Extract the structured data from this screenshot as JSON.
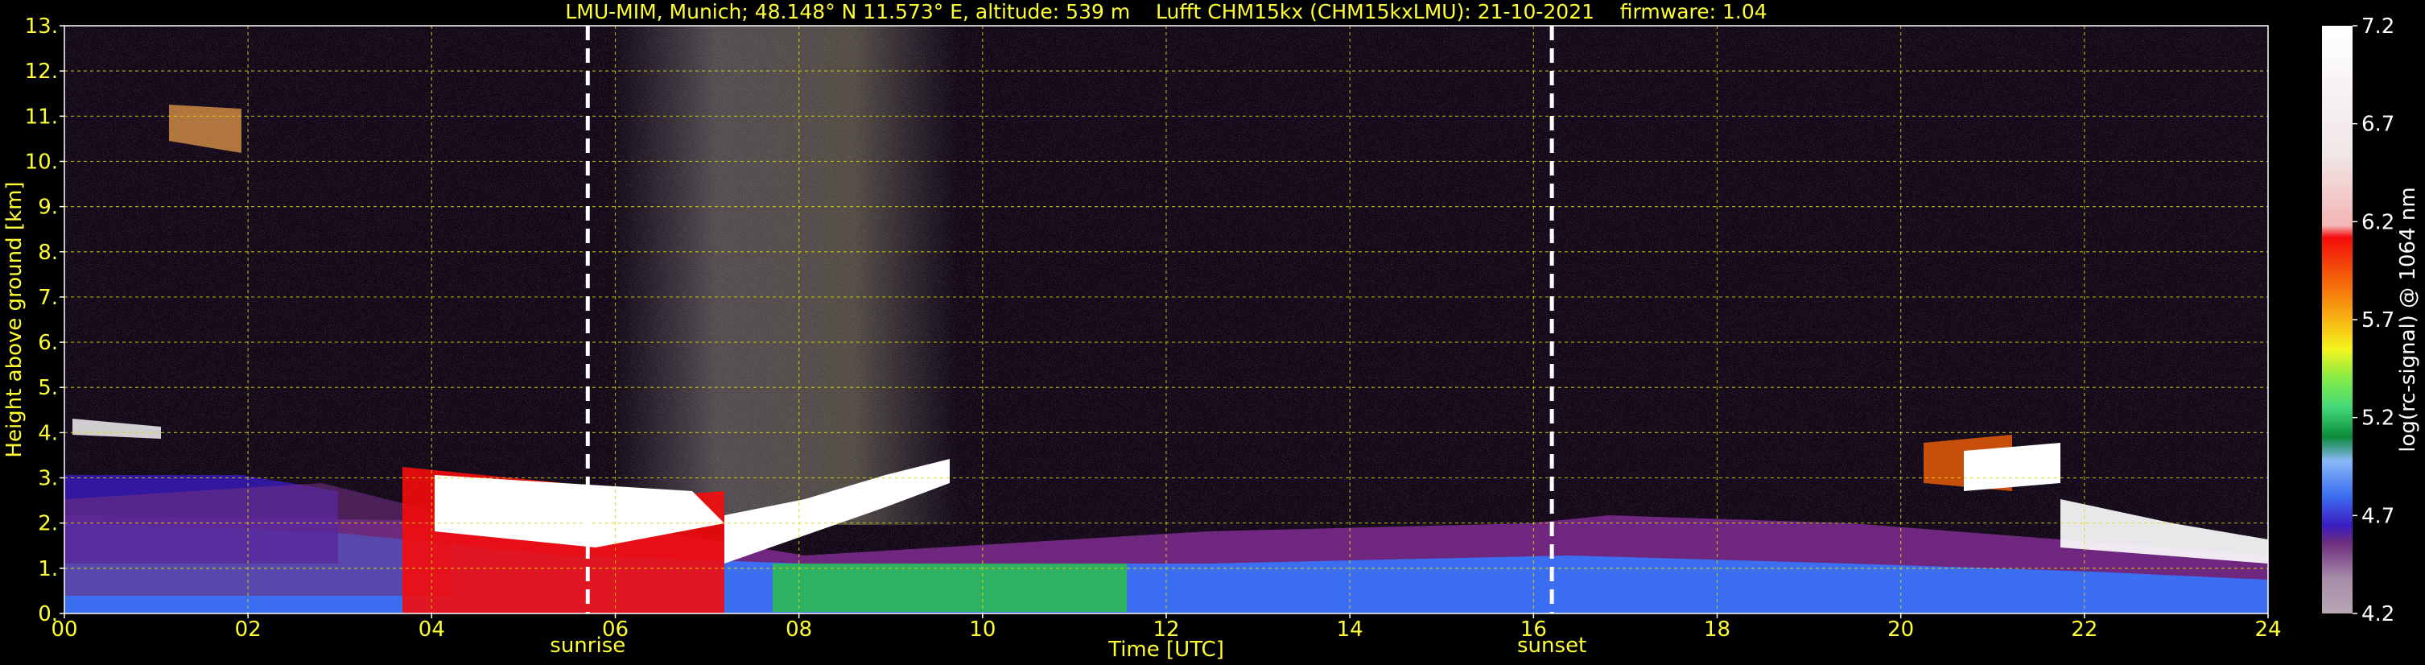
{
  "chart_data": {
    "type": "heatmap",
    "title": "LMU-MIM, Munich; 48.148° N 11.573° E, altitude: 539 m    Lufft CHM15kx (CHM15kxLMU): 21-10-2021    firmware: 1.04",
    "xlabel": "Time [UTC]",
    "ylabel": "Height above ground [km]",
    "xlim": [
      0,
      24
    ],
    "ylim": [
      0,
      13
    ],
    "x_ticks": [
      "00",
      "02",
      "04",
      "06",
      "08",
      "10",
      "12",
      "14",
      "16",
      "18",
      "20",
      "22",
      "24"
    ],
    "y_ticks": [
      "0.",
      "1.",
      "2.",
      "3.",
      "4.",
      "5.",
      "6.",
      "7.",
      "8.",
      "9.",
      "10.",
      "11.",
      "12.",
      "13."
    ],
    "grid": true,
    "colorbar": {
      "label": "log(rc-signal) @ 1064 nm",
      "range": [
        4.2,
        7.2
      ],
      "tick_labels": [
        "7.2",
        "6.7",
        "6.2",
        "5.7",
        "5.2",
        "4.7",
        "4.2"
      ],
      "tick_values": [
        7.2,
        6.7,
        6.2,
        5.7,
        5.2,
        4.7,
        4.2
      ],
      "colors": [
        "#b8a6b4",
        "#a58ca8",
        "#8c6496",
        "#6e2e7e",
        "#7a1c86",
        "#3a1cc0",
        "#2d3ee6",
        "#3b6ef0",
        "#5aa0f5",
        "#88b8f8",
        "#aacaf8",
        "#0a8a3a",
        "#16a03c",
        "#2cc04a",
        "#42d878",
        "#46e2b6",
        "#3ce8c8",
        "#84ec48",
        "#c8f02c",
        "#f4f41c",
        "#f8d414",
        "#f8a810",
        "#f88808",
        "#f46008",
        "#f03808",
        "#f40c0c",
        "#f4b4b4",
        "#ecd8d8",
        "#f4f4f4",
        "#ffffff"
      ]
    },
    "markers": [
      {
        "label": "sunrise",
        "x": 5.7
      },
      {
        "label": "sunset",
        "x": 16.2
      }
    ],
    "features": [
      {
        "kind": "boundary_layer",
        "x": [
          0,
          24
        ],
        "top_km": 2.0
      },
      {
        "kind": "low_cloud",
        "x": [
          3.3,
          7.2
        ],
        "base_km": 0.2,
        "top_km": 3.0
      },
      {
        "kind": "cloud_layer",
        "x": [
          7.2,
          9.3
        ],
        "base_km": 1.8,
        "top_km": 3.3
      },
      {
        "kind": "green_layer",
        "x": [
          8.0,
          11.0
        ],
        "base_km": 0.1,
        "top_km": 1.0
      },
      {
        "kind": "cloud",
        "x": [
          19.2,
          21.6
        ],
        "base_km": 2.8,
        "top_km": 3.6
      },
      {
        "kind": "cloud",
        "x": [
          21.6,
          24
        ],
        "base_km": 0.5,
        "top_km": 2.4
      },
      {
        "kind": "cirrus",
        "x": [
          1.0,
          2.0
        ],
        "base_km": 10.3,
        "top_km": 11.4
      },
      {
        "kind": "thin_cloud",
        "x": [
          0,
          1.0
        ],
        "base_km": 3.8,
        "top_km": 4.2
      }
    ]
  }
}
